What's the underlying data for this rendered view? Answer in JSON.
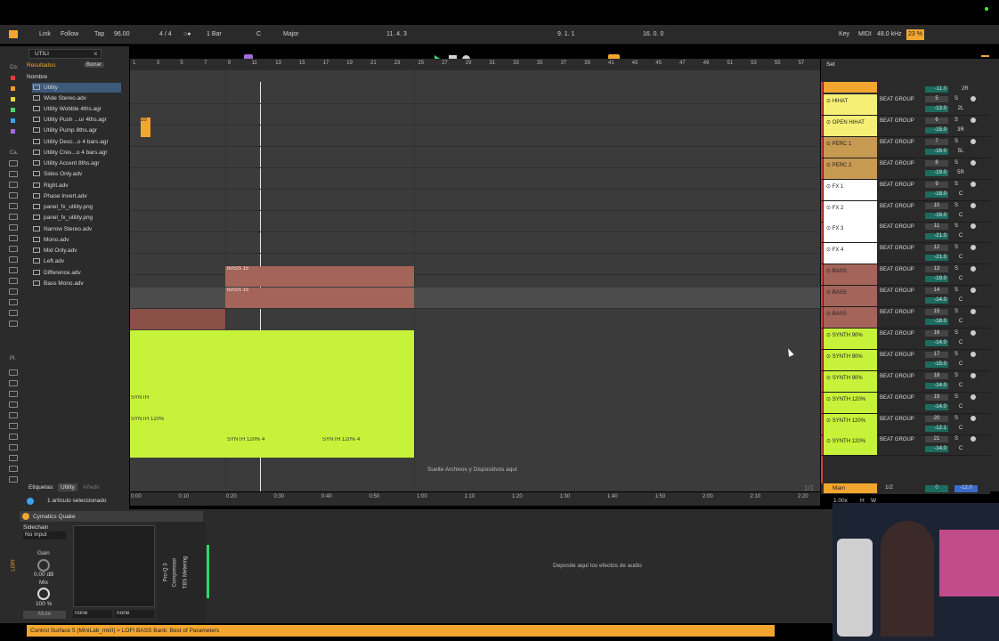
{
  "transport": {
    "link": "Link",
    "follow": "Follow",
    "tap": "Tap",
    "tempo": "96.00",
    "signature": "4 / 4",
    "metro": "○●",
    "quantize": "1 Bar",
    "key_root": "C",
    "key_scale": "Major",
    "position": "11.  4.  3",
    "loop_start": "9.  1.  1",
    "loop_length": "16.  0.  0",
    "key_label": "Key",
    "midi_label": "MIDI",
    "sample_rate": "48.0 kHz",
    "cpu": "23 %"
  },
  "browser": {
    "search": "UTILI",
    "results_label": "Resultados",
    "clear_label": "Borrar",
    "column_name": "Nombre",
    "items": [
      "Utility",
      "Wide Stereo.adv",
      "Utility Wobble 4ths.agr",
      "Utility Push ...ur 4ths.agr",
      "Utility Pump 8ths.agr",
      "Utility Desc...o 4 bars.agr",
      "Utility Cres...o 4 bars.agr",
      "Utility Accent 8ths.agr",
      "Sides Only.adv",
      "Right.adv",
      "Phase Invert.adv",
      "panel_fx_utility.png",
      "panel_fx_utility.png",
      "Narrow Stereo.adv",
      "Mono.adv",
      "Mid Only.adv",
      "Left.adv",
      "Difference.adv",
      "Bass Mono.adv"
    ],
    "tags_label": "Etiquetas:",
    "tag_value": "Utility",
    "tag_add": "Añadir",
    "selection_info": "1 artículo seleccionado",
    "sidebar_labels": [
      "Co.",
      "Ca.",
      "Pl."
    ]
  },
  "ruler_bars": [
    "1",
    "3",
    "5",
    "7",
    "9",
    "11",
    "13",
    "15",
    "17",
    "19",
    "21",
    "23",
    "25",
    "27",
    "29",
    "31",
    "33",
    "35",
    "37",
    "39",
    "41",
    "43",
    "45",
    "47",
    "49",
    "51",
    "53",
    "55",
    "57"
  ],
  "time_ticks": [
    "0:00",
    "0:10",
    "0:20",
    "0:30",
    "0:40",
    "0:50",
    "1:00",
    "1:10",
    "1:20",
    "1:30",
    "1:40",
    "1:50",
    "2:00",
    "2:10",
    "2:20"
  ],
  "arrangement": {
    "clip_bass_1": "BASS 15",
    "clip_bass_2": "BASS 15",
    "synth_label_a": "SYNTH",
    "synth_120": "SYNTH 120%",
    "synth_120_4a": "SYNTH 120% 4",
    "synth_120_4b": "SYNTH 120% 4",
    "small_clip": "10",
    "drop_files": "Suelte Archivos y Dispositivos aquí",
    "page_indicator": "1/1"
  },
  "set_label": "Set",
  "mixer": [
    {
      "name": "HIHAT",
      "route": "BEAT GROUP",
      "num": "5",
      "vol": "-13.0",
      "pan": "2L",
      "prev_vol": "-11.0",
      "prev_pan": "2R",
      "color": "#f5f075"
    },
    {
      "name": "OPEN HIHAT",
      "route": "BEAT GROUP",
      "num": "6",
      "vol": "-15.0",
      "pan": "3R",
      "color": "#f5f075"
    },
    {
      "name": "PERC 1",
      "route": "BEAT GROUP",
      "num": "7",
      "vol": "-16.0",
      "pan": "5L",
      "color": "#c79a52"
    },
    {
      "name": "PERC 2",
      "route": "BEAT GROUP",
      "num": "8",
      "vol": "-19.0",
      "pan": "5R",
      "color": "#c79a52"
    },
    {
      "name": "FX 1",
      "route": "BEAT GROUP",
      "num": "9",
      "vol": "-18.0",
      "pan": "C",
      "color": "#ffffff"
    },
    {
      "name": "FX 2",
      "route": "BEAT GROUP",
      "num": "10",
      "vol": "-16.0",
      "pan": "C",
      "color": "#ffffff"
    },
    {
      "name": "FX 3",
      "route": "BEAT GROUP",
      "num": "11",
      "vol": "-21.0",
      "pan": "C",
      "color": "#ffffff"
    },
    {
      "name": "FX 4",
      "route": "BEAT GROUP",
      "num": "12",
      "vol": "-21.0",
      "pan": "C",
      "color": "#ffffff"
    },
    {
      "name": "BASS",
      "route": "BEAT GROUP",
      "num": "13",
      "vol": "-19.0",
      "pan": "C",
      "color": "#a4645a"
    },
    {
      "name": "BASS",
      "route": "BEAT GROUP",
      "num": "14",
      "vol": "-14.0",
      "pan": "C",
      "color": "#a4645a"
    },
    {
      "name": "BASS",
      "route": "BEAT GROUP",
      "num": "15",
      "vol": "-18.0",
      "pan": "C",
      "color": "#a4645a"
    },
    {
      "name": "SYNTH 90%",
      "route": "BEAT GROUP",
      "num": "16",
      "vol": "-14.0",
      "pan": "C",
      "color": "#c7f23a"
    },
    {
      "name": "SYNTH 90%",
      "route": "BEAT GROUP",
      "num": "17",
      "vol": "-15.0",
      "pan": "C",
      "color": "#c7f23a"
    },
    {
      "name": "SYNTH 90%",
      "route": "BEAT GROUP",
      "num": "18",
      "vol": "-14.0",
      "pan": "C",
      "color": "#c7f23a"
    },
    {
      "name": "SYNTH 120%",
      "route": "BEAT GROUP",
      "num": "19",
      "vol": "-14.0",
      "pan": "C",
      "color": "#c7f23a"
    },
    {
      "name": "SYNTH 120%",
      "route": "BEAT GROUP",
      "num": "20",
      "vol": "-12.1",
      "pan": "C",
      "color": "#c7f23a"
    },
    {
      "name": "SYNTH 120%",
      "route": "BEAT GROUP",
      "num": "21",
      "vol": "-14.0",
      "pan": "C",
      "color": "#c7f23a"
    }
  ],
  "main_track": {
    "name": "Main",
    "route": "1/2",
    "vol": "0",
    "db": "-12.0",
    "zoom": "1.00x",
    "h": "H",
    "w": "W"
  },
  "device": {
    "name": "Cymatics Quake",
    "sidechain": "Sidechain",
    "input": "No Input",
    "gain_label": "Gain",
    "gain_value": "0.00 dB",
    "mix_label": "Mix",
    "mix_value": "100 %",
    "mute": "Mute",
    "dropdown_a": "none",
    "dropdown_b": "none",
    "rack_items": [
      "Pro-Q 3",
      "Compressor",
      "TBS Metering"
    ],
    "drop_effects": "Deposite aquí los efectos de audio",
    "side_label": "LOFI"
  },
  "status_text": "Control Surface 5 (MiniLab_mkII) > LOFI BASS Bank: Best of Parameters",
  "colors": {
    "accent": "#f2a62f",
    "synth": "#c7f23a",
    "bass": "#a4645a",
    "play": "#2fd66a"
  }
}
